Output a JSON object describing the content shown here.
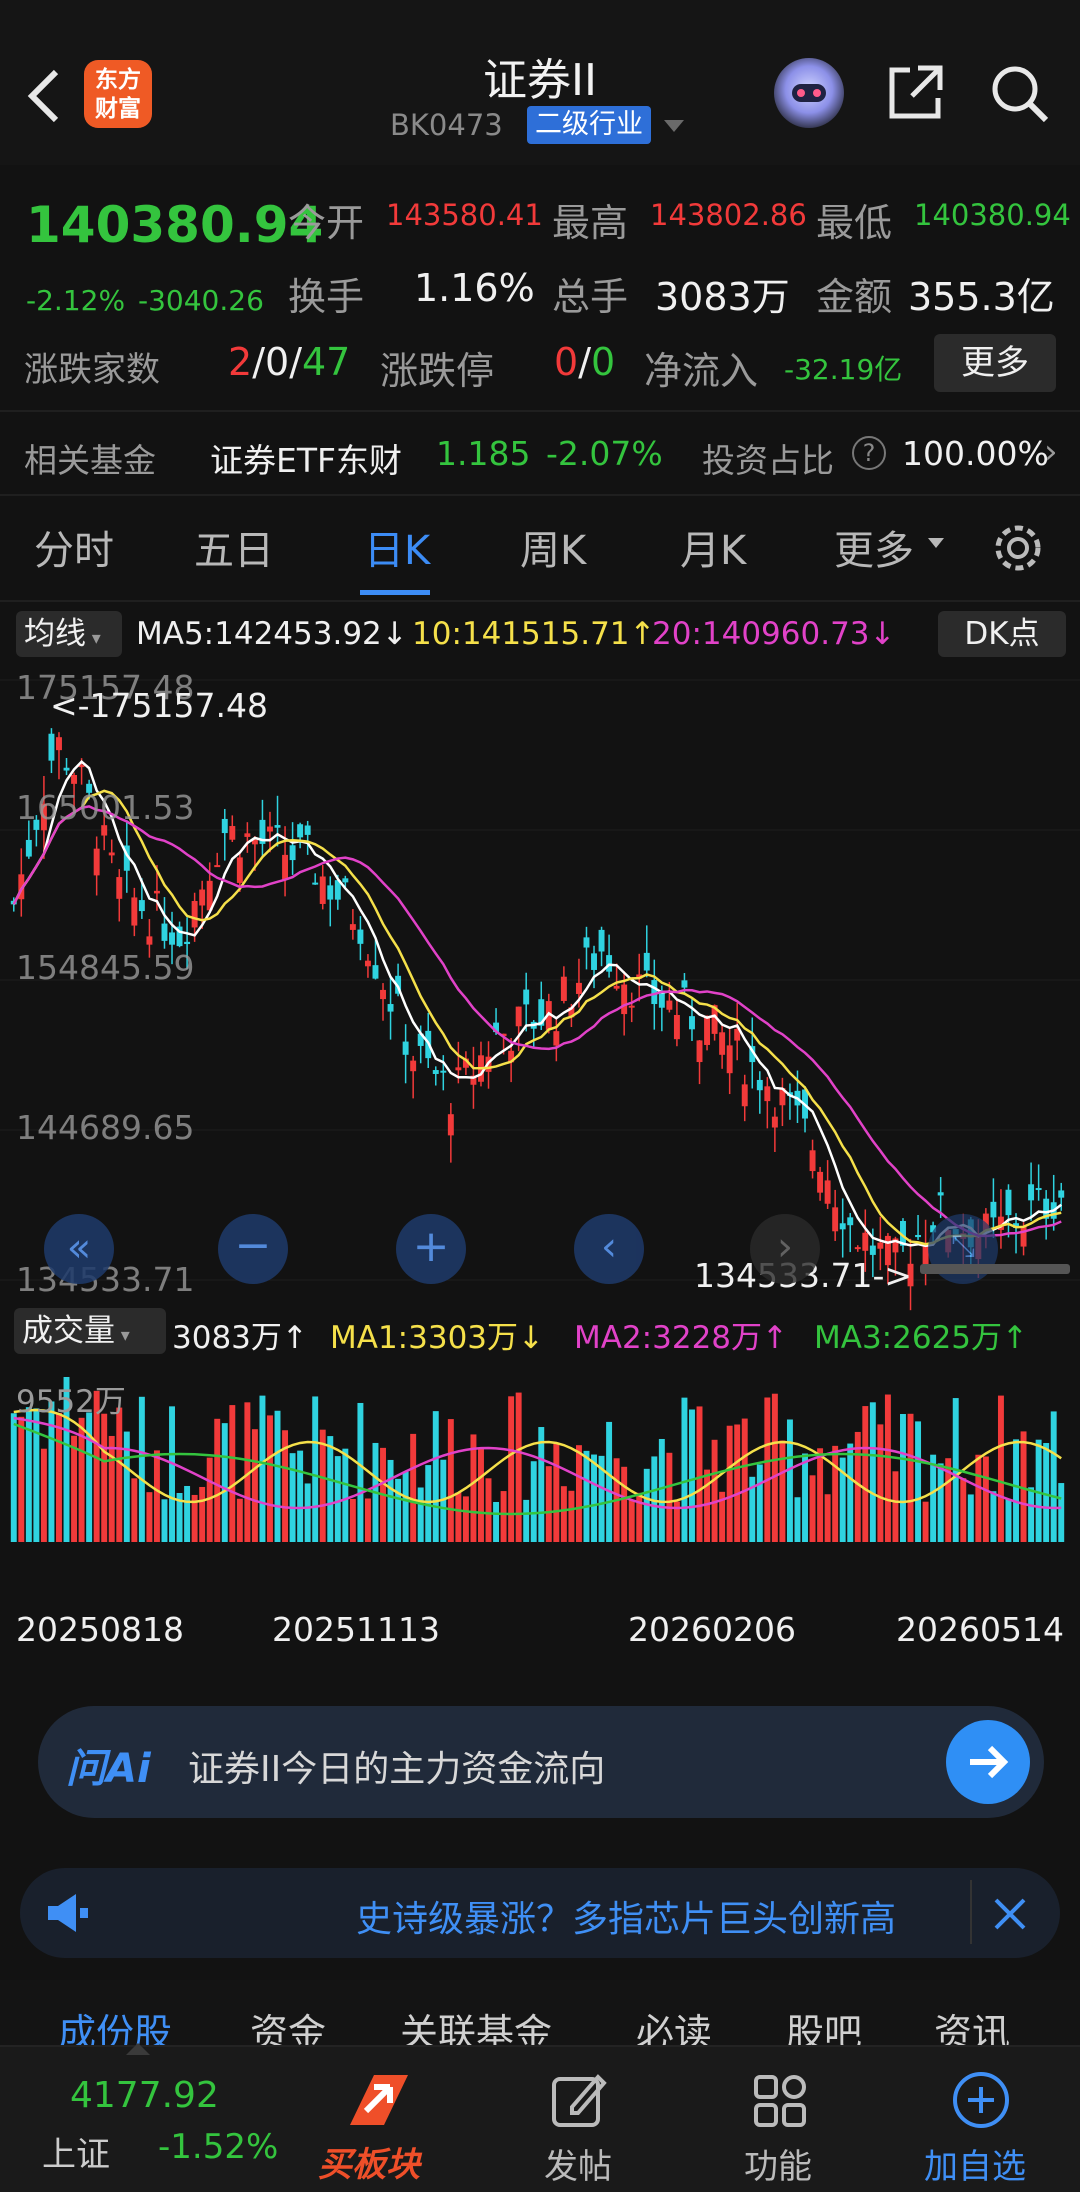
{
  "header": {
    "title": "证券II",
    "code": "BK0473",
    "tag": "二级行业",
    "logo_line1": "东方",
    "logo_line2": "财富",
    "icons": [
      "back-arrow-icon",
      "robot-avatar-icon",
      "share-icon",
      "search-icon"
    ]
  },
  "quote": {
    "price": "140380.94",
    "pct": "-2.12%",
    "chg": "-3040.26",
    "open_label": "今开",
    "open": "143580.41",
    "high_label": "最高",
    "high": "143802.86",
    "low_label": "最低",
    "low": "140380.94",
    "turn_label": "换手",
    "turn": "1.16%",
    "vol_label": "总手",
    "vol": "3083万",
    "amt_label": "金额",
    "amt": "355.3亿",
    "breadth_label": "涨跌家数",
    "up": "2",
    "flat": "0",
    "down": "47",
    "limit_label": "涨跌停",
    "limit_up": "0",
    "limit_down": "0",
    "flow_label": "净流入",
    "flow": "-32.19亿",
    "more": "更多"
  },
  "fund": {
    "label": "相关基金",
    "name": "证券ETF东财",
    "price": "1.185",
    "pct": "-2.07%",
    "ratio_label": "投资占比",
    "ratio": "100.00%"
  },
  "tabs": [
    "分时",
    "五日",
    "日K",
    "周K",
    "月K",
    "更多"
  ],
  "chart": {
    "ma_chip": "均线",
    "ma5": "MA5:142453.92↓",
    "ma10": "10:141515.71↑",
    "ma20": "20:140960.73↓",
    "dk": "DK点",
    "y_labels": [
      "175157.48",
      "165001.53",
      "154845.59",
      "144689.65",
      "134533.71"
    ],
    "max_mark": "<-175157.48",
    "min_mark": "134533.71->",
    "vol_chip": "成交量",
    "vol_now": "3083万↑",
    "vma1": "MA1:3303万↓",
    "vma2": "MA2:3228万↑",
    "vma3": "MA3:2625万↑",
    "vol_max": "9552万",
    "dates": [
      "20250818",
      "20251113",
      "20260206",
      "20260514"
    ]
  },
  "chart_data": {
    "type": "candlestick",
    "y_range": [
      134533.71,
      175157.48
    ],
    "max": 175157.48,
    "min": 134533.71,
    "last_close": 140380.94,
    "volume_max_wan": 9552
  },
  "ai": {
    "logo": "问Ai",
    "text": "证券II今日的主力资金流向"
  },
  "banner": {
    "text": "史诗级暴涨？多指芯片巨头创新高"
  },
  "subtabs": [
    "成份股",
    "资金",
    "关联基金",
    "必读",
    "股吧",
    "资讯"
  ],
  "bottom": {
    "index_value": "4177.92",
    "index_name": "上证",
    "index_pct": "-1.52%",
    "buy": "买板块",
    "post": "发帖",
    "func": "功能",
    "add": "加自选"
  }
}
